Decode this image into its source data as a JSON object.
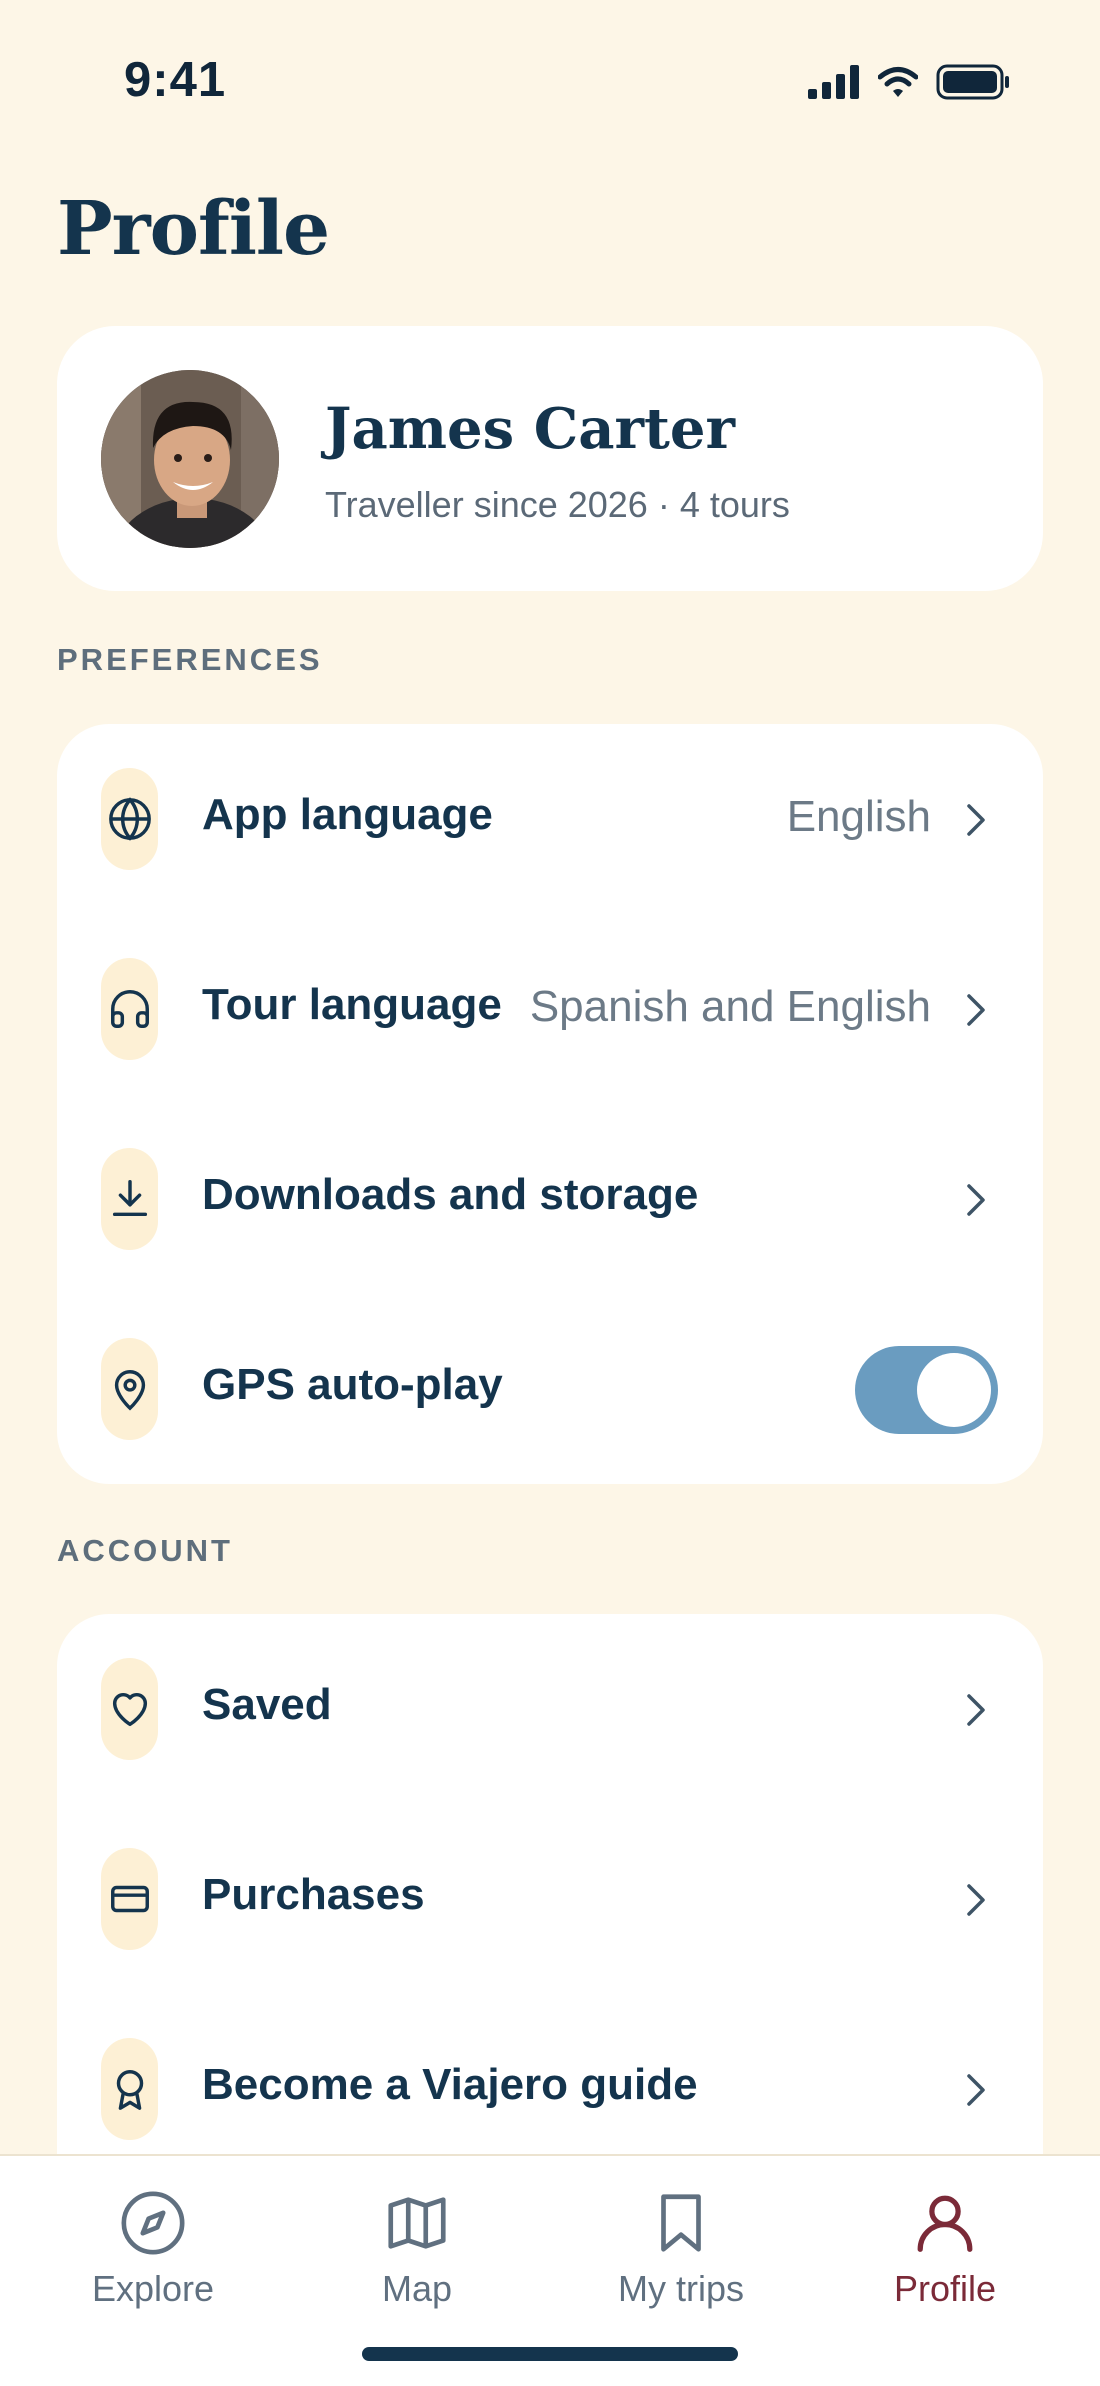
{
  "status_bar": {
    "time": "9:41"
  },
  "page": {
    "title": "Profile"
  },
  "profile": {
    "name": "James Carter",
    "subtitle": "Traveller since 2026 · 4 tours"
  },
  "preferences": {
    "section_label": "PREFERENCES",
    "items": [
      {
        "icon": "globe-icon",
        "label": "App language",
        "value": "English"
      },
      {
        "icon": "headphones-icon",
        "label": "Tour language",
        "value": "Spanish and English"
      },
      {
        "icon": "download-icon",
        "label": "Downloads and storage",
        "value": ""
      },
      {
        "icon": "location-pin-icon",
        "label": "GPS auto-play",
        "toggle": true
      }
    ]
  },
  "account": {
    "section_label": "ACCOUNT",
    "items": [
      {
        "icon": "heart-icon",
        "label": "Saved"
      },
      {
        "icon": "credit-card-icon",
        "label": "Purchases"
      },
      {
        "icon": "award-icon",
        "label": "Become a Viajero guide"
      }
    ]
  },
  "tab_bar": {
    "tabs": [
      {
        "icon": "compass-icon",
        "label": "Explore"
      },
      {
        "icon": "map-icon",
        "label": "Map"
      },
      {
        "icon": "bookmark-icon",
        "label": "My trips"
      },
      {
        "icon": "person-icon",
        "label": "Profile",
        "active": true
      }
    ]
  },
  "colors": {
    "background": "#fdf6e7",
    "primary_text": "#14344d",
    "toggle_on": "#6a9cc0",
    "active_tab": "#7b2a38",
    "icon_pill": "#fdf0d5"
  }
}
